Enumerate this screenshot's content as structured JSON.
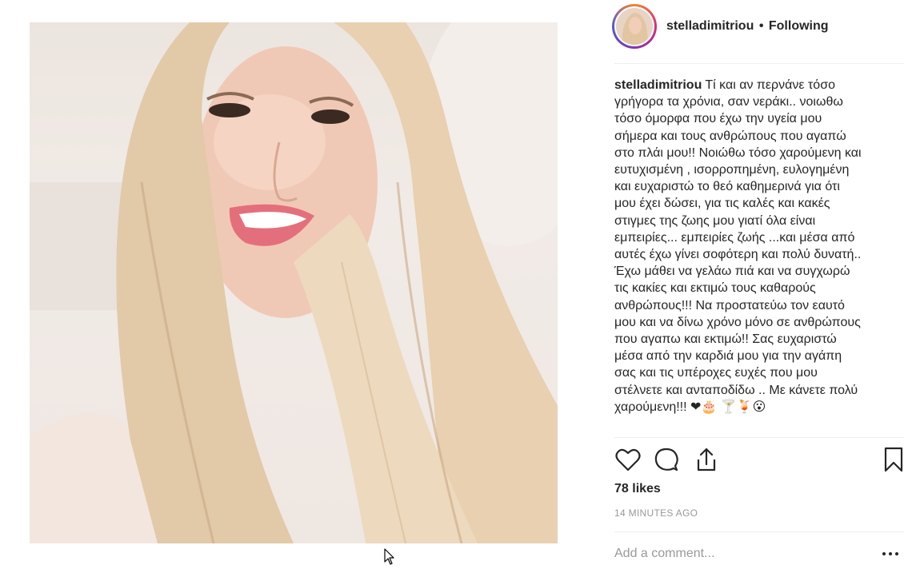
{
  "post": {
    "image_alt": "Selfie photo",
    "author": {
      "username": "stelladimitriou",
      "separator": "•",
      "follow_status": "Following"
    },
    "caption": {
      "username": "stelladimitriou",
      "text": "Τί και αν περνάνε τόσο γρήγορα τα χρόνια, σαν νεράκι.. νοιωθω τόσο όμορφα που έχω την υγεία μου σήμερα και τους ανθρώπους που αγαπώ στο πλάι μου!! Νοιώθω τόσο χαρούμενη και ευτυχισμένη , ισορροπημένη, ευλογημένη και ευχαριστώ το θεό καθημερινά για ότι μου έχει δώσει, για τις καλές και κακές στιγμες της ζωης μου γιατί όλα είναι εμπειρίες... εμπειρίες ζωής ...και μέσα από αυτές έχω γίνει σοφότερη και πολύ δυνατή.. Έχω μάθει να γελάω πιά και να συγχωρώ τις κακίες και εκτιμώ τους καθαρούς ανθρώπους!!! Να προστατεύω τον εαυτό μου και να δίνω χρόνο μόνο σε ανθρώπους που αγαπω και εκτιμώ!! Σας ευχαριστώ μέσα από την καρδιά μου για την αγάπη σας και τις υπέροχες ευχές που μου στέλνετε και ανταποδίδω .. Με κάνετε πολύ χαρούμενη!!! ❤🎂 🍸🍹😮"
    },
    "actions": {
      "like_icon": "heart-outline-icon",
      "comment_icon": "speech-bubble-icon",
      "share_icon": "share-upload-icon",
      "save_icon": "bookmark-icon"
    },
    "likes_text": "78 likes",
    "timestamp": "14 MINUTES AGO",
    "comment_box": {
      "placeholder": "Add a comment...",
      "value": ""
    },
    "more_options_icon": "ellipsis-icon"
  },
  "colors": {
    "text": "#262626",
    "muted": "#999999",
    "divider": "#efefef",
    "ring_gradient": [
      "#f58529",
      "#dd2a7b",
      "#8134af",
      "#515bd4"
    ]
  }
}
